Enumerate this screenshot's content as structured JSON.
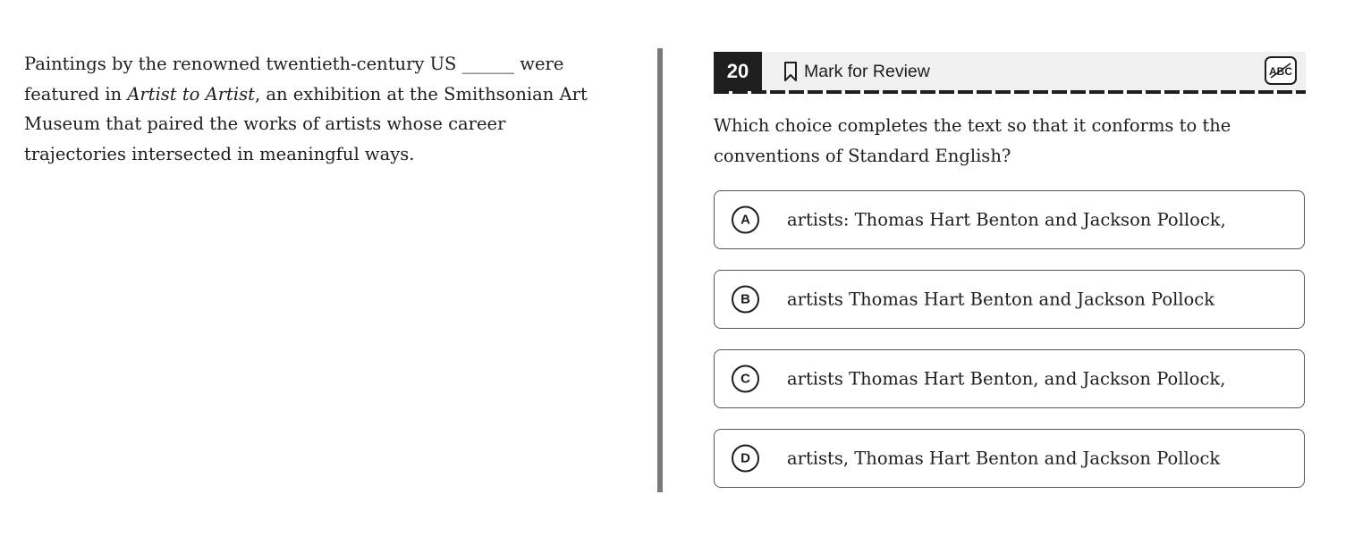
{
  "passage": {
    "part1": "Paintings by the renowned twentieth-century US ______ were featured in ",
    "title_italic": "Artist to Artist",
    "part2": ", an exhibition at the Smithsonian Art Museum that paired the works of artists whose career trajectories intersected in meaningful ways."
  },
  "question_header": {
    "number": "20",
    "mark_label": "Mark for Review",
    "bookmark_icon": "bookmark-icon",
    "strike_tool_icon": "abc-strikethrough-icon",
    "strike_tool_text": "ABC"
  },
  "question_text": "Which choice completes the text so that it conforms to the conventions of Standard English?",
  "choices": [
    {
      "letter": "A",
      "text": "artists: Thomas Hart Benton and Jackson Pollock,"
    },
    {
      "letter": "B",
      "text": "artists Thomas Hart Benton and Jackson Pollock"
    },
    {
      "letter": "C",
      "text": "artists Thomas Hart Benton, and Jackson Pollock,"
    },
    {
      "letter": "D",
      "text": "artists, Thomas Hart Benton and Jackson Pollock"
    }
  ],
  "colors": {
    "text": "#1e1e1e",
    "header_bg": "#f0f0f0",
    "divider": "#7a7a7a",
    "choice_border": "#555555"
  }
}
